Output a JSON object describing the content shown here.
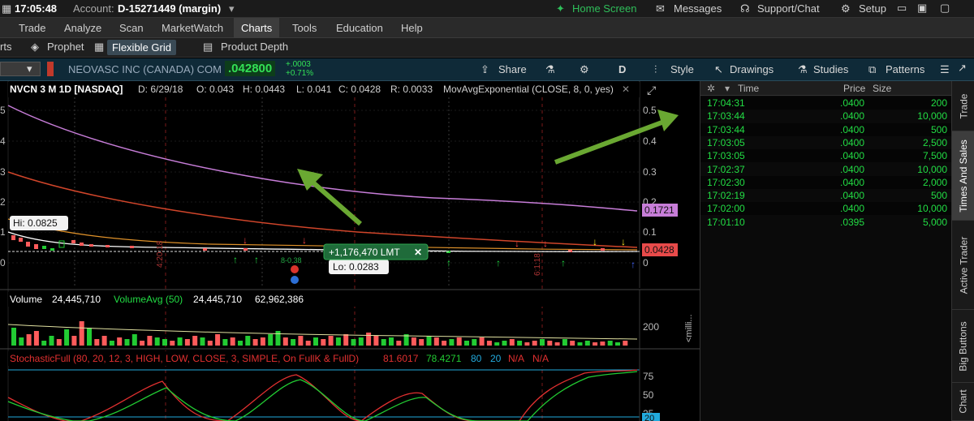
{
  "topbar": {
    "time": "17:05:48",
    "account_label": "Account:",
    "account_value": "D-15271449 (margin)",
    "home_screen": "Home Screen",
    "messages": "Messages",
    "support_chat": "Support/Chat",
    "setup": "Setup"
  },
  "menu": [
    "Trade",
    "Analyze",
    "Scan",
    "MarketWatch",
    "Charts",
    "Tools",
    "Education",
    "Help"
  ],
  "menu_active": "Charts",
  "submenu": [
    "rts",
    "Prophet",
    "Flexible Grid",
    "Product Depth"
  ],
  "chart_toolbar": {
    "company": "NEOVASC INC (CANADA) COM",
    "last_price": ".042800",
    "change": "+.0003",
    "change_pct": "+0.71%",
    "share": "Share",
    "period": "D",
    "style": "Style",
    "drawings": "Drawings",
    "studies": "Studies",
    "patterns": "Patterns"
  },
  "chart_header": {
    "symbol": "NVCN 3 M 1D [NASDAQ]",
    "date": "D: 6/29/18",
    "open": "O: 0.043",
    "high": "H: 0.0443",
    "low": "L: 0.041",
    "close": "C: 0.0428",
    "range": "R: 0.0033",
    "study": "MovAvgExponential (CLOSE, 8, 0, yes)"
  },
  "chart_labels": {
    "hi_label": "Hi: 0.0825",
    "lo_label": "Lo: 0.0283",
    "order_label": "+1,176,470 LMT",
    "price_tag_purple": "0.1721",
    "price_tag_red": "0.0428",
    "yaxis_ticks": [
      "0.5",
      "0.4",
      "0.3",
      "0.2",
      "0.1",
      "0"
    ],
    "left_ticks": [
      "5",
      "4",
      "3",
      "2",
      "1",
      "0"
    ],
    "split_label_1": "4:20:18",
    "split_label_2": "6:1:18",
    "bubble_text": "8-0.38"
  },
  "volume": {
    "label": "Volume",
    "value": "24,445,710",
    "avg_label": "VolumeAvg (50)",
    "avg_value": "24,445,710",
    "extra": "62,962,386",
    "axis_tick": "200",
    "axis_label": "<milli..."
  },
  "stochastic": {
    "label": "StochasticFull (80, 20, 12, 3, HIGH, LOW, CLOSE, 3, SIMPLE, On FullK & FullD)",
    "k": "81.6017",
    "d": "78.4271",
    "ob": "80",
    "os": "20",
    "na1": "N/A",
    "na2": "N/A",
    "ticks": [
      "75",
      "50",
      "25",
      "20"
    ]
  },
  "time_sales": {
    "columns": [
      "Time",
      "Price",
      "Size"
    ],
    "rows": [
      {
        "time": "17:04:31",
        "price": ".0400",
        "size": "200"
      },
      {
        "time": "17:03:44",
        "price": ".0400",
        "size": "10,000"
      },
      {
        "time": "17:03:44",
        "price": ".0400",
        "size": "500"
      },
      {
        "time": "17:03:05",
        "price": ".0400",
        "size": "2,500"
      },
      {
        "time": "17:03:05",
        "price": ".0400",
        "size": "7,500"
      },
      {
        "time": "17:02:37",
        "price": ".0400",
        "size": "10,000"
      },
      {
        "time": "17:02:30",
        "price": ".0400",
        "size": "2,000"
      },
      {
        "time": "17:02:19",
        "price": ".0400",
        "size": "500"
      },
      {
        "time": "17:02:00",
        "price": ".0400",
        "size": "10,000"
      },
      {
        "time": "17:01:10",
        "price": ".0395",
        "size": "5,000"
      }
    ]
  },
  "side_tabs": [
    "Trade",
    "Times And Sales",
    "Active Trader",
    "Big Buttons",
    "Chart"
  ],
  "colors": {
    "green_text": "#22dd44",
    "accent_green": "#6aa832",
    "purple_ma": "#c77dd8",
    "red_ma": "#d0452a",
    "up_bar": "#22cc33",
    "down_bar": "#ff5b5b"
  }
}
